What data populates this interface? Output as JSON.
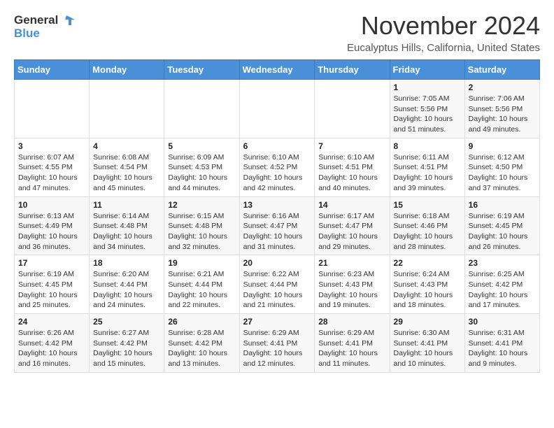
{
  "logo": {
    "line1": "General",
    "line2": "Blue"
  },
  "title": "November 2024",
  "subtitle": "Eucalyptus Hills, California, United States",
  "days_of_week": [
    "Sunday",
    "Monday",
    "Tuesday",
    "Wednesday",
    "Thursday",
    "Friday",
    "Saturday"
  ],
  "weeks": [
    [
      {
        "day": "",
        "info": ""
      },
      {
        "day": "",
        "info": ""
      },
      {
        "day": "",
        "info": ""
      },
      {
        "day": "",
        "info": ""
      },
      {
        "day": "",
        "info": ""
      },
      {
        "day": "1",
        "info": "Sunrise: 7:05 AM\nSunset: 5:56 PM\nDaylight: 10 hours and 51 minutes."
      },
      {
        "day": "2",
        "info": "Sunrise: 7:06 AM\nSunset: 5:56 PM\nDaylight: 10 hours and 49 minutes."
      }
    ],
    [
      {
        "day": "3",
        "info": "Sunrise: 6:07 AM\nSunset: 4:55 PM\nDaylight: 10 hours and 47 minutes."
      },
      {
        "day": "4",
        "info": "Sunrise: 6:08 AM\nSunset: 4:54 PM\nDaylight: 10 hours and 45 minutes."
      },
      {
        "day": "5",
        "info": "Sunrise: 6:09 AM\nSunset: 4:53 PM\nDaylight: 10 hours and 44 minutes."
      },
      {
        "day": "6",
        "info": "Sunrise: 6:10 AM\nSunset: 4:52 PM\nDaylight: 10 hours and 42 minutes."
      },
      {
        "day": "7",
        "info": "Sunrise: 6:10 AM\nSunset: 4:51 PM\nDaylight: 10 hours and 40 minutes."
      },
      {
        "day": "8",
        "info": "Sunrise: 6:11 AM\nSunset: 4:51 PM\nDaylight: 10 hours and 39 minutes."
      },
      {
        "day": "9",
        "info": "Sunrise: 6:12 AM\nSunset: 4:50 PM\nDaylight: 10 hours and 37 minutes."
      }
    ],
    [
      {
        "day": "10",
        "info": "Sunrise: 6:13 AM\nSunset: 4:49 PM\nDaylight: 10 hours and 36 minutes."
      },
      {
        "day": "11",
        "info": "Sunrise: 6:14 AM\nSunset: 4:48 PM\nDaylight: 10 hours and 34 minutes."
      },
      {
        "day": "12",
        "info": "Sunrise: 6:15 AM\nSunset: 4:48 PM\nDaylight: 10 hours and 32 minutes."
      },
      {
        "day": "13",
        "info": "Sunrise: 6:16 AM\nSunset: 4:47 PM\nDaylight: 10 hours and 31 minutes."
      },
      {
        "day": "14",
        "info": "Sunrise: 6:17 AM\nSunset: 4:47 PM\nDaylight: 10 hours and 29 minutes."
      },
      {
        "day": "15",
        "info": "Sunrise: 6:18 AM\nSunset: 4:46 PM\nDaylight: 10 hours and 28 minutes."
      },
      {
        "day": "16",
        "info": "Sunrise: 6:19 AM\nSunset: 4:45 PM\nDaylight: 10 hours and 26 minutes."
      }
    ],
    [
      {
        "day": "17",
        "info": "Sunrise: 6:19 AM\nSunset: 4:45 PM\nDaylight: 10 hours and 25 minutes."
      },
      {
        "day": "18",
        "info": "Sunrise: 6:20 AM\nSunset: 4:44 PM\nDaylight: 10 hours and 24 minutes."
      },
      {
        "day": "19",
        "info": "Sunrise: 6:21 AM\nSunset: 4:44 PM\nDaylight: 10 hours and 22 minutes."
      },
      {
        "day": "20",
        "info": "Sunrise: 6:22 AM\nSunset: 4:44 PM\nDaylight: 10 hours and 21 minutes."
      },
      {
        "day": "21",
        "info": "Sunrise: 6:23 AM\nSunset: 4:43 PM\nDaylight: 10 hours and 19 minutes."
      },
      {
        "day": "22",
        "info": "Sunrise: 6:24 AM\nSunset: 4:43 PM\nDaylight: 10 hours and 18 minutes."
      },
      {
        "day": "23",
        "info": "Sunrise: 6:25 AM\nSunset: 4:42 PM\nDaylight: 10 hours and 17 minutes."
      }
    ],
    [
      {
        "day": "24",
        "info": "Sunrise: 6:26 AM\nSunset: 4:42 PM\nDaylight: 10 hours and 16 minutes."
      },
      {
        "day": "25",
        "info": "Sunrise: 6:27 AM\nSunset: 4:42 PM\nDaylight: 10 hours and 15 minutes."
      },
      {
        "day": "26",
        "info": "Sunrise: 6:28 AM\nSunset: 4:42 PM\nDaylight: 10 hours and 13 minutes."
      },
      {
        "day": "27",
        "info": "Sunrise: 6:29 AM\nSunset: 4:41 PM\nDaylight: 10 hours and 12 minutes."
      },
      {
        "day": "28",
        "info": "Sunrise: 6:29 AM\nSunset: 4:41 PM\nDaylight: 10 hours and 11 minutes."
      },
      {
        "day": "29",
        "info": "Sunrise: 6:30 AM\nSunset: 4:41 PM\nDaylight: 10 hours and 10 minutes."
      },
      {
        "day": "30",
        "info": "Sunrise: 6:31 AM\nSunset: 4:41 PM\nDaylight: 10 hours and 9 minutes."
      }
    ]
  ],
  "colors": {
    "header_bg": "#4a90d9",
    "header_text": "#ffffff",
    "accent": "#4a90d9"
  }
}
